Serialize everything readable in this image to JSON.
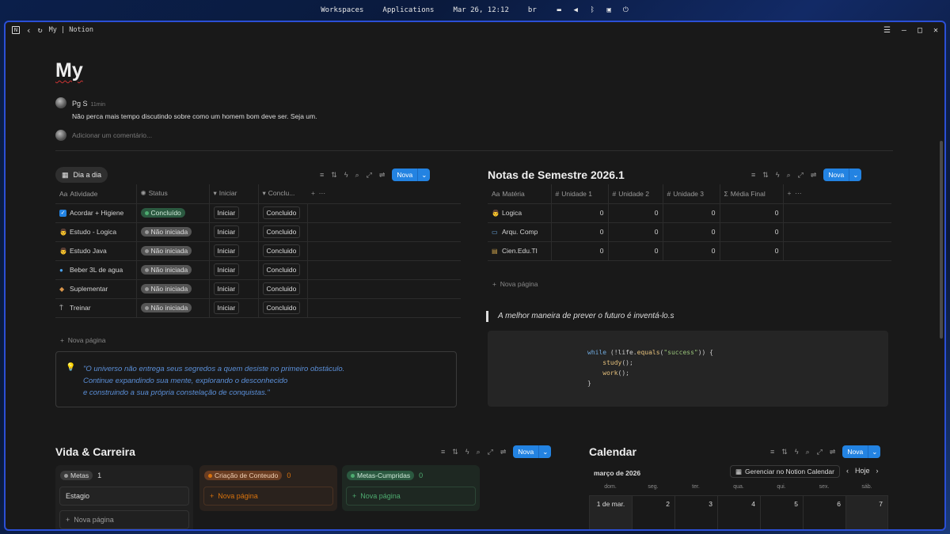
{
  "system_bar": {
    "workspaces": "Workspaces",
    "applications": "Applications",
    "clock": "Mar 26, 12:12",
    "keyboard": "br"
  },
  "window": {
    "title": "My | Notion"
  },
  "page": {
    "title": "My"
  },
  "comment": {
    "author": "Pg S",
    "time": "11min",
    "text": "Não perca mais tempo discutindo sobre como um homem bom deve ser. Seja um.",
    "add_placeholder": "Adicionar um comentário..."
  },
  "daily": {
    "view_label": "Dia a dia",
    "new_label": "Nova",
    "columns": [
      "Atividade",
      "Status",
      "Iniciar",
      "Conclu..."
    ],
    "rows": [
      {
        "activity": "Acordar + Higiene",
        "icon": "checkbox-icon",
        "status": "Concluído",
        "start": "Iniciar",
        "done": "Concluido"
      },
      {
        "activity": "Estudo - Logica",
        "icon": "student-icon",
        "status": "Não iniciada",
        "start": "Iniciar",
        "done": "Concluido"
      },
      {
        "activity": "Estudo Java",
        "icon": "student-icon",
        "status": "Não iniciada",
        "start": "Iniciar",
        "done": "Concluido"
      },
      {
        "activity": "Beber 3L de agua",
        "icon": "droplet-icon",
        "status": "Não iniciada",
        "start": "Iniciar",
        "done": "Concluido"
      },
      {
        "activity": "Suplementar",
        "icon": "muscle-icon",
        "status": "Não iniciada",
        "start": "Iniciar",
        "done": "Concluido"
      },
      {
        "activity": "Treinar",
        "icon": "dumbbell-icon",
        "status": "Não iniciada",
        "start": "Iniciar",
        "done": "Concluido"
      }
    ],
    "add_page": "Nova página"
  },
  "callout": {
    "line1": "\"O universo não entrega seus segredos a quem desiste no primeiro obstáculo.",
    "line2": "Continue expandindo sua mente, explorando o desconhecido",
    "line3": "e construindo a sua própria constelação de conquistas.\""
  },
  "grades": {
    "title": "Notas de Semestre 2026.1",
    "new_label": "Nova",
    "columns": [
      "Matéria",
      "Unidade 1",
      "Unidade 2",
      "Unidade 3",
      "Média Final"
    ],
    "rows": [
      {
        "subject": "Logica",
        "icon": "student-icon",
        "u1": "0",
        "u2": "0",
        "u3": "0",
        "avg": "0"
      },
      {
        "subject": "Arqu. Comp",
        "icon": "computer-icon",
        "u1": "0",
        "u2": "0",
        "u3": "0",
        "avg": "0"
      },
      {
        "subject": "Cien.Edu.TI",
        "icon": "book-icon",
        "u1": "0",
        "u2": "0",
        "u3": "0",
        "avg": "0"
      }
    ],
    "add_page": "Nova página"
  },
  "quote": "A melhor maneira de prever o futuro é inventá-lo.s",
  "code": {
    "l1a": "while",
    "l1b": " (!life.",
    "l1c": "equals",
    "l1d": "(",
    "l1e": "\"success\"",
    "l1f": ")) {",
    "l2": "study",
    "l3": "work"
  },
  "career": {
    "title": "Vida & Carreira",
    "new_label": "Nova",
    "groups": [
      {
        "name": "Metas",
        "count": "1",
        "card": "Estagio",
        "add": "Nova página"
      },
      {
        "name": "Criação de Conteudo",
        "count": "0",
        "add": "Nova página"
      },
      {
        "name": "Metas-Cumpridas",
        "count": "0",
        "add": "Nova página"
      }
    ]
  },
  "calendar": {
    "title": "Calendar",
    "new_label": "Nova",
    "month": "março de 2026",
    "manage": "Gerenciar no Notion Calendar",
    "today": "Hoje",
    "weekdays": [
      "dom.",
      "seg.",
      "ter.",
      "qua.",
      "qui.",
      "sex.",
      "sáb."
    ],
    "days": [
      "1 de mar.",
      "2",
      "3",
      "4",
      "5",
      "6",
      "7"
    ]
  }
}
